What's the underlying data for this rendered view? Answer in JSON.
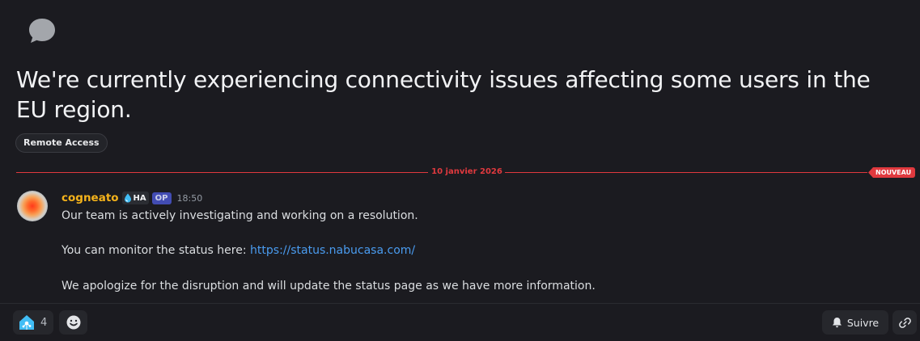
{
  "thread": {
    "title": "We're currently experiencing connectivity issues affecting some users in the EU region.",
    "tag": "Remote Access",
    "icon": "chat-bubble-icon"
  },
  "divider": {
    "date": "10 janvier 2026",
    "new_label": "NOUVEAU",
    "color": "#e0393e"
  },
  "message": {
    "author": "cogneato",
    "author_color": "#f5b31b",
    "role_badge": "HA",
    "op_badge": "OP",
    "time": "18:50",
    "line1": "Our team is actively investigating and working on a resolution.",
    "line2_prefix": "You can monitor the status here: ",
    "line2_link": "https://status.nabucasa.com/",
    "line3": "We apologize for the disruption and will update the status page as we have more information."
  },
  "footer": {
    "reaction_icon": "home-assistant-icon",
    "reaction_count": "4",
    "add_reaction_icon": "smiley-icon",
    "follow_label": "Suivre",
    "follow_icon": "bell-icon",
    "copy_link_icon": "link-icon"
  }
}
